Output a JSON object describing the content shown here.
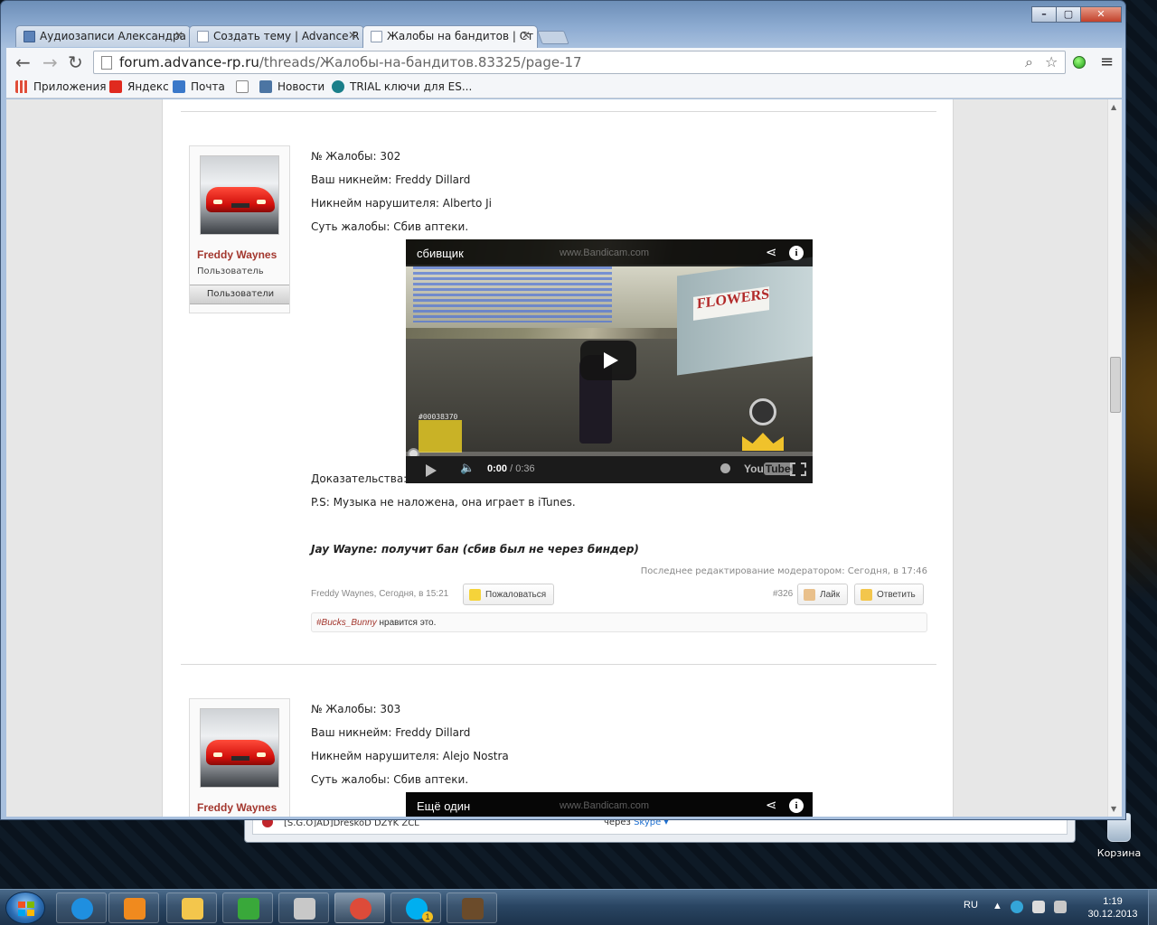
{
  "window": {
    "title": "Жалобы на бандитов | Ст",
    "controls": [
      "–",
      "▢",
      "✕"
    ]
  },
  "tabs": [
    {
      "label": "Аудиозаписи Александра",
      "icon": "audio-icon"
    },
    {
      "label": "Создать тему | Advance R",
      "icon": "page-icon"
    },
    {
      "label": "Жалобы на бандитов | Ст",
      "icon": "page-icon",
      "active": true
    }
  ],
  "toolbar": {
    "back": "←",
    "forward": "→",
    "reload": "↻",
    "url_host": "forum.advance-rp.ru",
    "url_path": "/threads/Жалобы-на-бандитов.83325/page-17",
    "search_icon": "magnifier-icon",
    "star_icon": "star-icon",
    "menu": "≡"
  },
  "bookmarks": [
    {
      "label": "Приложения",
      "icon": "apps-grid-icon",
      "color": "#e04e3a"
    },
    {
      "label": "Яндекс",
      "icon": "yandex-icon",
      "color": "#e02a1f"
    },
    {
      "label": "Почта",
      "icon": "mail-icon",
      "color": "#3a78c9"
    },
    {
      "label": "",
      "icon": "page-icon",
      "color": "#ffffff"
    },
    {
      "label": "Новости",
      "icon": "vk-icon",
      "color": "#4c75a3"
    },
    {
      "label": "TRIAL ключи для ES...",
      "icon": "eset-icon",
      "color": "#1b7f8a"
    }
  ],
  "posts": [
    {
      "author": "Freddy Waynes",
      "user_title": "Пользователь",
      "user_group": "Пользователи",
      "lines": [
        "№ Жалобы: 302",
        "Ваш никнейм: Freddy Dillard",
        "Никнейм нарушителя: Alberto Ji",
        "Суть жалобы: Сбив аптеки."
      ],
      "video": {
        "title": "сбивщик",
        "watermark": "www.Bandicam.com",
        "time_current": "0:00",
        "time_duration": "/ 0:36",
        "brand": "You",
        "brand_tube": "Tube",
        "progress": 0
      },
      "evidence_label": "Доказательства:",
      "ps": "P.S: Музыка не наложена, она играет в iTunes.",
      "moderator_note": "Jay Wayne: получит бан (сбив был не через биндер)",
      "edit_note": "Последнее редактирование модератором: Сегодня, в 17:46",
      "meta": "Freddy Waynes, Сегодня, в 15:21",
      "report_label": "Пожаловаться",
      "post_number": "#326",
      "like_label": "Лайк",
      "reply_label": "Ответить",
      "liker": "#Bucks_Bunny",
      "likes_text": "нравится это."
    },
    {
      "author": "Freddy Waynes",
      "lines": [
        "№ Жалобы: 303",
        "Ваш никнейм: Freddy Dillard",
        "Никнейм нарушителя: Alejo Nostra",
        "Суть жалобы: Сбив аптеки."
      ],
      "video": {
        "title": "Ещё один",
        "watermark": "www.Bandicam.com"
      }
    }
  ],
  "background_window": {
    "left_text": "[S.G.O]AD]DreskoD DZYK ZCL",
    "right_text": "через",
    "right_link": "Skype ▾"
  },
  "desktop": {
    "recycle_bin": "Корзина"
  },
  "taskbar": {
    "apps": [
      {
        "name": "ie",
        "color": "#1f8fe0"
      },
      {
        "name": "media-player",
        "color": "#f08a1e"
      },
      {
        "name": "explorer",
        "color": "#f3c64c"
      },
      {
        "name": "qip",
        "color": "#39a83a"
      },
      {
        "name": "terminal-99",
        "color": "#c8c8c8"
      },
      {
        "name": "chrome",
        "color": "#dd4b39",
        "active": true
      },
      {
        "name": "skype",
        "color": "#00aff0",
        "badge": "1"
      },
      {
        "name": "gta-sa",
        "color": "#6b4b2a"
      }
    ],
    "language": "RU",
    "time": "1:19",
    "date": "30.12.2013"
  }
}
